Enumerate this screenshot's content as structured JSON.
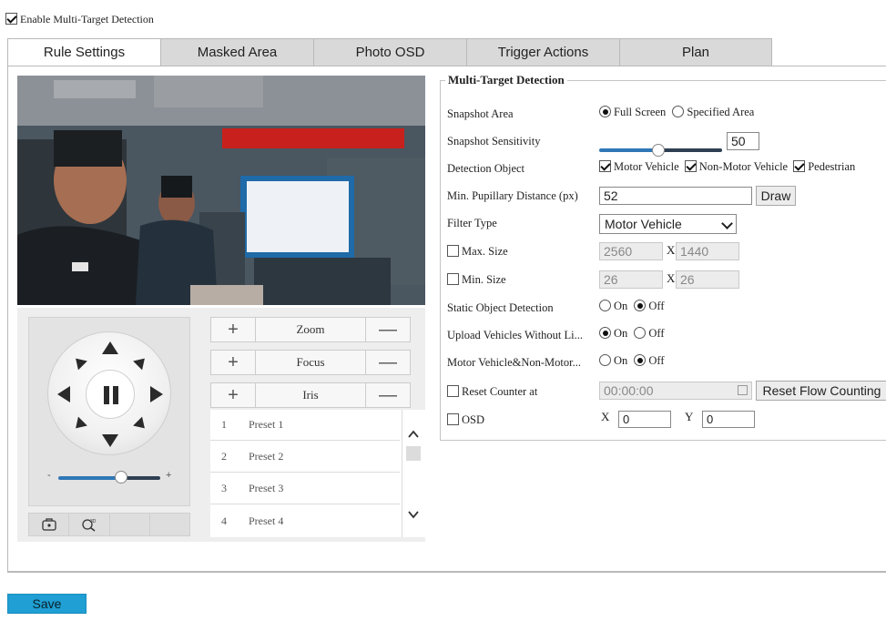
{
  "enable": {
    "label": "Enable Multi-Target Detection",
    "checked": true
  },
  "tabs": [
    {
      "label": "Rule Settings",
      "active": true
    },
    {
      "label": "Masked Area",
      "active": false
    },
    {
      "label": "Photo OSD",
      "active": false
    },
    {
      "label": "Trigger Actions",
      "active": false
    },
    {
      "label": "Plan",
      "active": false
    }
  ],
  "ptz": {
    "zoom_label": "Zoom",
    "focus_label": "Focus",
    "iris_label": "Iris",
    "plus": "+",
    "minus": "—",
    "speed_min": "-",
    "speed_max": "+",
    "speed_level": 0.6,
    "presets": [
      {
        "num": "1",
        "name": "Preset 1"
      },
      {
        "num": "2",
        "name": "Preset 2"
      },
      {
        "num": "3",
        "name": "Preset 3"
      },
      {
        "num": "4",
        "name": "Preset 4"
      }
    ]
  },
  "mtd": {
    "title": "Multi-Target Detection",
    "snapshot_area": {
      "label": "Snapshot Area",
      "opt_full": "Full Screen",
      "opt_specified": "Specified Area",
      "selected": "Full Screen"
    },
    "snapshot_sensitivity": {
      "label": "Snapshot Sensitivity",
      "value": "50"
    },
    "detection_object": {
      "label": "Detection Object",
      "motor": "Motor Vehicle",
      "nonmotor": "Non-Motor Vehicle",
      "pedestrian": "Pedestrian"
    },
    "pupillary": {
      "label": "Min. Pupillary Distance (px)",
      "value": "52",
      "draw": "Draw"
    },
    "filter_type": {
      "label": "Filter Type",
      "value": "Motor Vehicle"
    },
    "max_size": {
      "label": "Max. Size",
      "w": "2560",
      "x": "X",
      "h": "1440"
    },
    "min_size": {
      "label": "Min. Size",
      "w": "26",
      "x": "X",
      "h": "26"
    },
    "static_obj": {
      "label": "Static Object Detection",
      "on": "On",
      "off": "Off",
      "selected": "Off"
    },
    "upload_vehicles": {
      "label": "Upload Vehicles Without Li...",
      "on": "On",
      "off": "Off",
      "selected": "On"
    },
    "motor_nonmotor": {
      "label": "Motor Vehicle&Non-Motor...",
      "on": "On",
      "off": "Off",
      "selected": "Off"
    },
    "reset_counter": {
      "label": "Reset Counter at",
      "time": "00:00:00",
      "button": "Reset Flow Counting"
    },
    "osd": {
      "label": "OSD",
      "x_label": "X",
      "x_value": "0",
      "y_label": "Y",
      "y_value": "0"
    }
  },
  "save_label": "Save"
}
